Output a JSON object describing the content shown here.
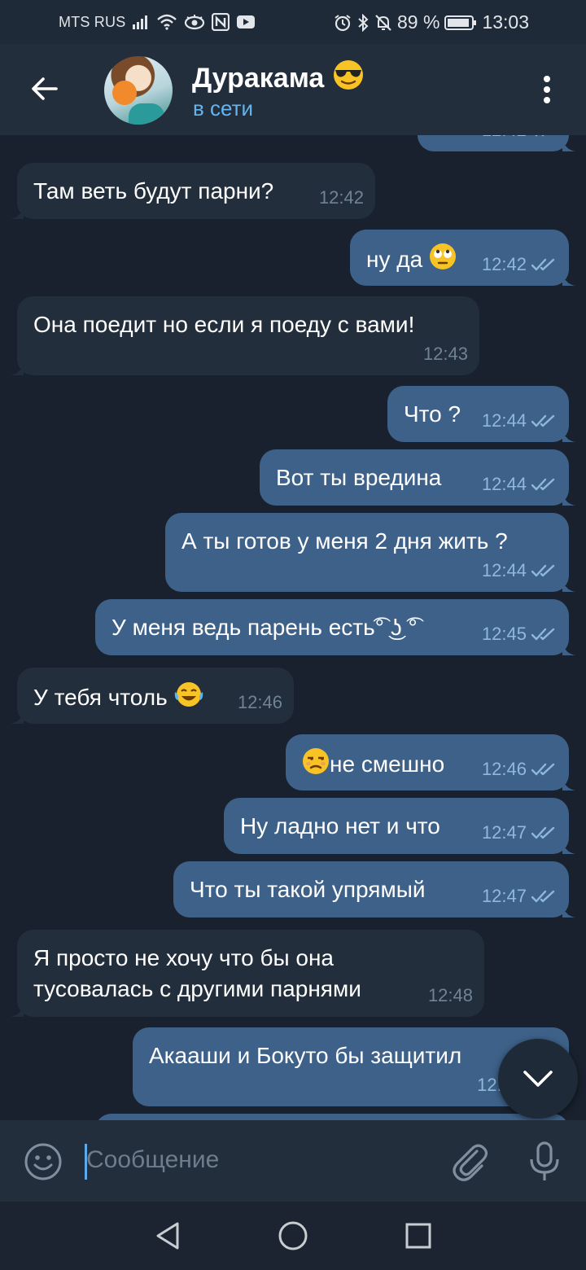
{
  "status_bar": {
    "carrier": "MTS RUS",
    "battery": "89 %",
    "time": "13:03"
  },
  "header": {
    "name": "Дуракама",
    "name_emoji": "smiling-face-with-sunglasses",
    "status": "в сети",
    "status_color": "#64b5ef"
  },
  "messages": [
    {
      "dir": "out",
      "text": "",
      "time": "12:42",
      "read": true,
      "partial": true
    },
    {
      "dir": "in",
      "text": "Там веть будут парни?",
      "time": "12:42"
    },
    {
      "dir": "out",
      "text": "ну да",
      "emoji": "face-with-rolling-eyes",
      "time": "12:42",
      "read": true
    },
    {
      "dir": "in",
      "text": "Она поедит но если я поеду с вами!",
      "time": "12:43"
    },
    {
      "dir": "out",
      "text": "Что ?",
      "time": "12:44",
      "read": true
    },
    {
      "dir": "out",
      "text": "Вот ты вредина",
      "time": "12:44",
      "read": true
    },
    {
      "dir": "out",
      "text": "А ты готов у меня 2 дня жить ?",
      "time": "12:44",
      "read": true
    },
    {
      "dir": "out",
      "text": "У меня ведь парень есть͡° ͜ʖ ͡°",
      "time": "12:45",
      "read": true
    },
    {
      "dir": "in",
      "text": "У тебя чтоль",
      "emoji": "face-with-tears-of-joy",
      "time": "12:46"
    },
    {
      "dir": "out",
      "text": "не смешно",
      "emoji_before": "unamused-face",
      "time": "12:46",
      "read": true
    },
    {
      "dir": "out",
      "text": "Ну ладно нет и что",
      "time": "12:47",
      "read": true
    },
    {
      "dir": "out",
      "text": "Что ты такой упрямый",
      "time": "12:47",
      "read": true
    },
    {
      "dir": "in",
      "lines": [
        "Я просто не хочу что бы она",
        "тусовалась с другими парнями"
      ],
      "time": "12:48"
    },
    {
      "dir": "out",
      "text": "Акааши и Бокуто бы защитил",
      "time": "12:4",
      "read": true,
      "partial": true
    }
  ],
  "input": {
    "placeholder": "Сообщение"
  },
  "colors": {
    "background": "#18212d",
    "header": "#232e3c",
    "incoming_bubble": "#232e3c",
    "outgoing_bubble": "#3e6189",
    "accent": "#5da9e9"
  },
  "icons": {
    "back": "arrow-left-icon",
    "menu": "more-vertical-icon",
    "emoji": "smile-icon",
    "attach": "paperclip-icon",
    "mic": "microphone-icon",
    "scroll_down": "chevron-down-icon"
  }
}
